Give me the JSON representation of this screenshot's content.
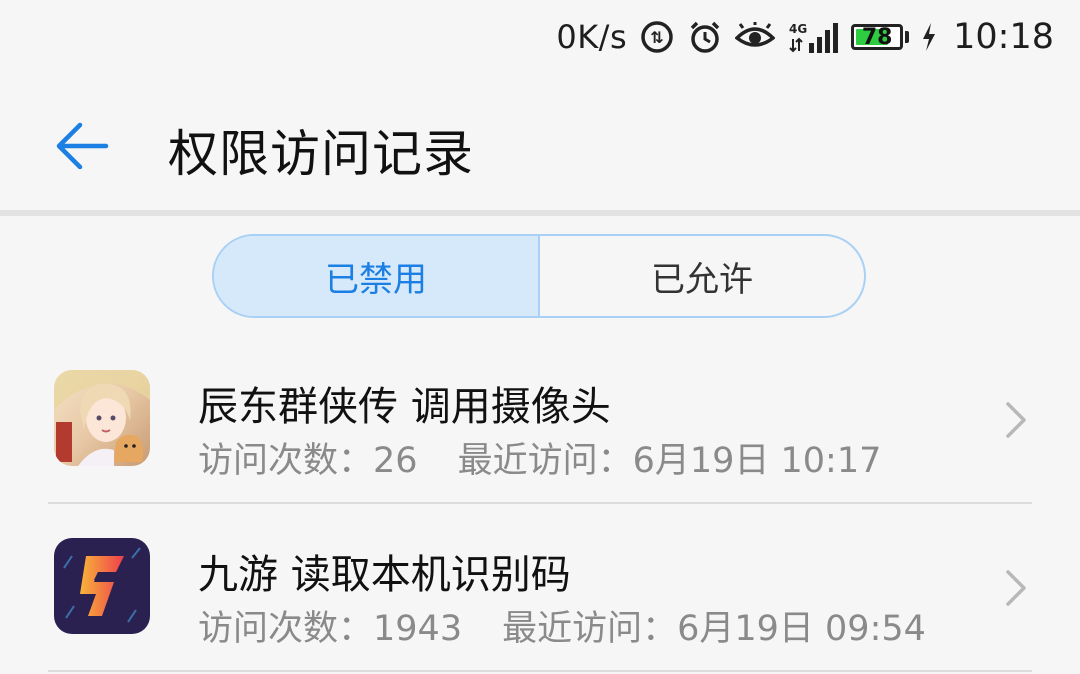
{
  "status_bar": {
    "net_speed": "0K/s",
    "signal_label": "4G",
    "battery_percent": 78,
    "battery_text": "78",
    "time": "10:18",
    "icons": [
      "data-saver-icon",
      "alarm-icon",
      "eye-comfort-icon",
      "signal-icon",
      "battery-icon",
      "charging-icon"
    ]
  },
  "header": {
    "title": "权限访问记录",
    "back_icon": "back-arrow-icon"
  },
  "tabs": [
    {
      "label": "已禁用",
      "active": true
    },
    {
      "label": "已允许",
      "active": false
    }
  ],
  "records": [
    {
      "title": "辰东群侠传 调用摄像头",
      "count_label": "访问次数：",
      "count": "26",
      "recent_label": "最近访问：",
      "recent": "6月19日 10:17",
      "icon": "game-app-icon"
    },
    {
      "title": "九游 读取本机识别码",
      "count_label": "访问次数：",
      "count": "1943",
      "recent_label": "最近访问：",
      "recent": "6月19日 09:54",
      "icon": "jiuyou-app-icon"
    }
  ],
  "colors": {
    "accent": "#1b7fe3",
    "segment_border": "#a9d0f5",
    "segment_active_bg": "#d6e9fb",
    "battery_fill": "#2ecc40"
  }
}
